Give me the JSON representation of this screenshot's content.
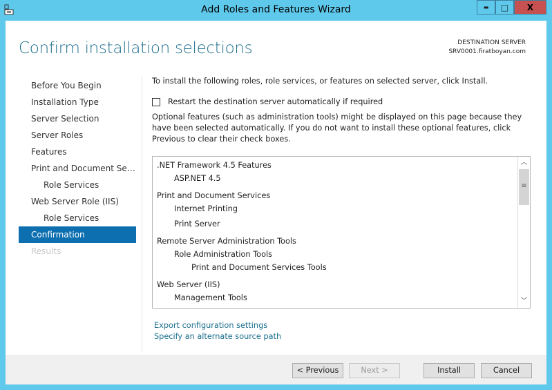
{
  "window": {
    "title": "Add Roles and Features Wizard",
    "minimize": "▬",
    "maximize": "□",
    "close": "X",
    "close_color": "#c75050"
  },
  "header": {
    "title": "Confirm installation selections",
    "dest_label": "DESTINATION SERVER",
    "dest_server": "SRV0001.firatboyan.com"
  },
  "sidebar": {
    "items": [
      {
        "label": "Before You Begin",
        "state": "normal"
      },
      {
        "label": "Installation Type",
        "state": "normal"
      },
      {
        "label": "Server Selection",
        "state": "normal"
      },
      {
        "label": "Server Roles",
        "state": "normal"
      },
      {
        "label": "Features",
        "state": "normal"
      },
      {
        "label": "Print and Document Services",
        "state": "normal"
      },
      {
        "label": "Role Services",
        "state": "sub"
      },
      {
        "label": "Web Server Role (IIS)",
        "state": "normal"
      },
      {
        "label": "Role Services",
        "state": "sub"
      },
      {
        "label": "Confirmation",
        "state": "selected"
      },
      {
        "label": "Results",
        "state": "disabled"
      }
    ]
  },
  "main": {
    "intro": "To install the following roles, role services, or features on selected server, click Install.",
    "restart_label": "Restart the destination server automatically if required",
    "restart_checked": false,
    "optional_text": "Optional features (such as administration tools) might be displayed on this page because they have been selected automatically. If you do not want to install these optional features, click Previous to clear their check boxes.",
    "features": [
      {
        "label": ".NET Framework 4.5 Features",
        "level": 0
      },
      {
        "label": "ASP.NET 4.5",
        "level": 1
      },
      {
        "label": "Print and Document Services",
        "level": 0
      },
      {
        "label": "Internet Printing",
        "level": 1
      },
      {
        "label": "Print Server",
        "level": 1
      },
      {
        "label": "Remote Server Administration Tools",
        "level": 0
      },
      {
        "label": "Role Administration Tools",
        "level": 1
      },
      {
        "label": "Print and Document Services Tools",
        "level": 2
      },
      {
        "label": "Web Server (IIS)",
        "level": 0
      },
      {
        "label": "Management Tools",
        "level": 1
      }
    ],
    "export_link": "Export configuration settings",
    "source_link": "Specify an alternate source path"
  },
  "footer": {
    "previous": "< Previous",
    "next": "Next >",
    "install": "Install",
    "cancel": "Cancel"
  }
}
